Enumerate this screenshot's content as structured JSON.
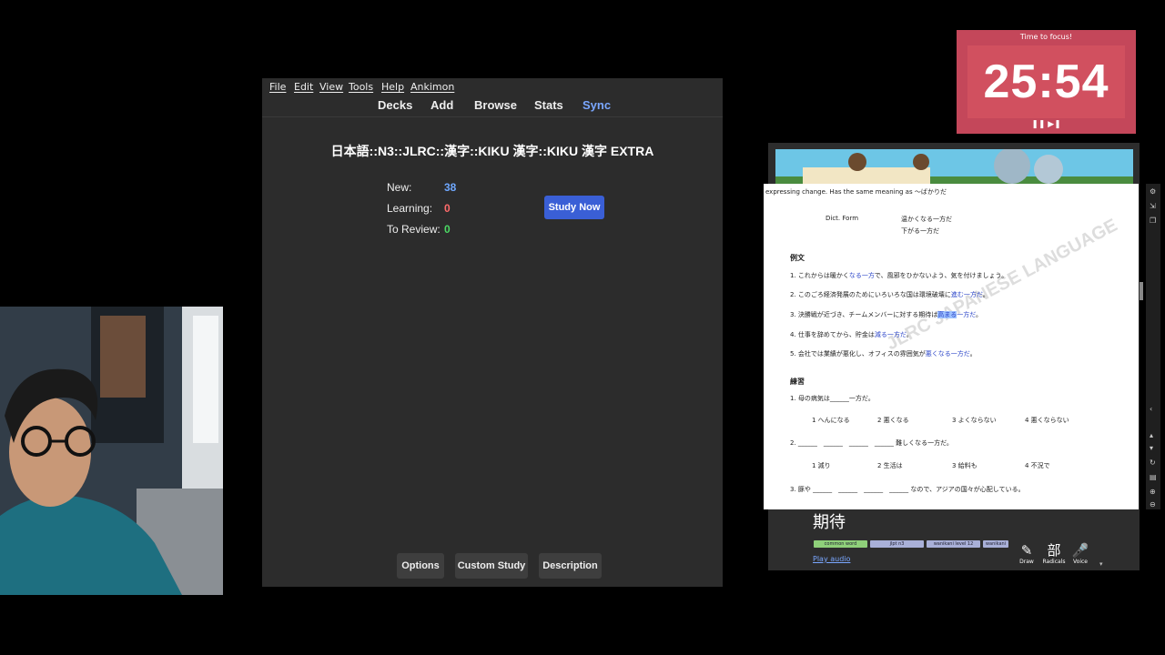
{
  "anki": {
    "menu": [
      "File",
      "Edit",
      "View",
      "Tools",
      "Help",
      "Ankimon"
    ],
    "toolbar": {
      "decks": "Decks",
      "add": "Add",
      "browse": "Browse",
      "stats": "Stats",
      "sync": "Sync"
    },
    "deck_title": "日本語::N3::JLRC::漢字::KIKU 漢字::KIKU 漢字 EXTRA",
    "stats": {
      "new_label": "New:",
      "new_value": "38",
      "learning_label": "Learning:",
      "learning_value": "0",
      "review_label": "To Review:",
      "review_value": "0"
    },
    "study_now": "Study Now",
    "bottom": {
      "options": "Options",
      "custom_study": "Custom Study",
      "description": "Description"
    },
    "colors": {
      "new": "#6fa8ff",
      "learning": "#ff6b6b",
      "review": "#4cd964",
      "accent": "#3a5fd6"
    }
  },
  "timer": {
    "label": "Time to focus!",
    "time": "25:54",
    "controls": "❚❚ ▶❚"
  },
  "grammar_doc": {
    "intro": "expressing change. Has the same meaning as ～ばかりだ",
    "form_label": "Dict. Form",
    "form_ex1": "温かくなる一方だ",
    "form_ex2": "下がる一方だ",
    "examples_heading": "例文",
    "examples": [
      {
        "pre": "1. これからは暖かく",
        "hi": "なる一方",
        "post": "で、風邪をひかないよう、気を付けましょう。"
      },
      {
        "pre": "2. このごろ経済発展のためにいろいろな国は環境破壊に",
        "hi": "進む一方だ",
        "post": "。"
      },
      {
        "pre": "3. 決勝戦が近づき、チームメンバーに対する期待は",
        "hi": "高まる",
        "post2": "一方だ",
        "post": "。"
      },
      {
        "pre": "4. 仕事を辞めてから、貯金は",
        "hi": "減る一方だ",
        "post": "。"
      },
      {
        "pre": "5. 会社では業績が悪化し、オフィスの雰囲気が",
        "hi": "悪くなる一方だ",
        "post": "。"
      }
    ],
    "practice_heading": "練習",
    "q1": "1. 母の病気は______一方だ。",
    "q1_options": [
      "1 へんになる",
      "2 悪くなる",
      "3 よくならない",
      "4 悪くならない"
    ],
    "q2": "2. ______　______　______　______ 難しくなる一方だ。",
    "q2_options": [
      "1 減り",
      "2 生活は",
      "3 給料も",
      "4 不況で"
    ],
    "q3": "3. 豚や ______　______　______　______ なので、アジアの国々が心配している。",
    "watermark": "JLRC JAPANESE LANGUAGE"
  },
  "dictionary": {
    "word": "期待",
    "tags": [
      "common word",
      "jlpt n3",
      "wanikani level 12",
      "wanikani"
    ],
    "play_audio": "Play audio",
    "tools": [
      {
        "label": "Draw",
        "glyph": "✎"
      },
      {
        "label": "Radicals",
        "glyph": "部"
      },
      {
        "label": "Voice",
        "glyph": "🎤"
      }
    ]
  }
}
